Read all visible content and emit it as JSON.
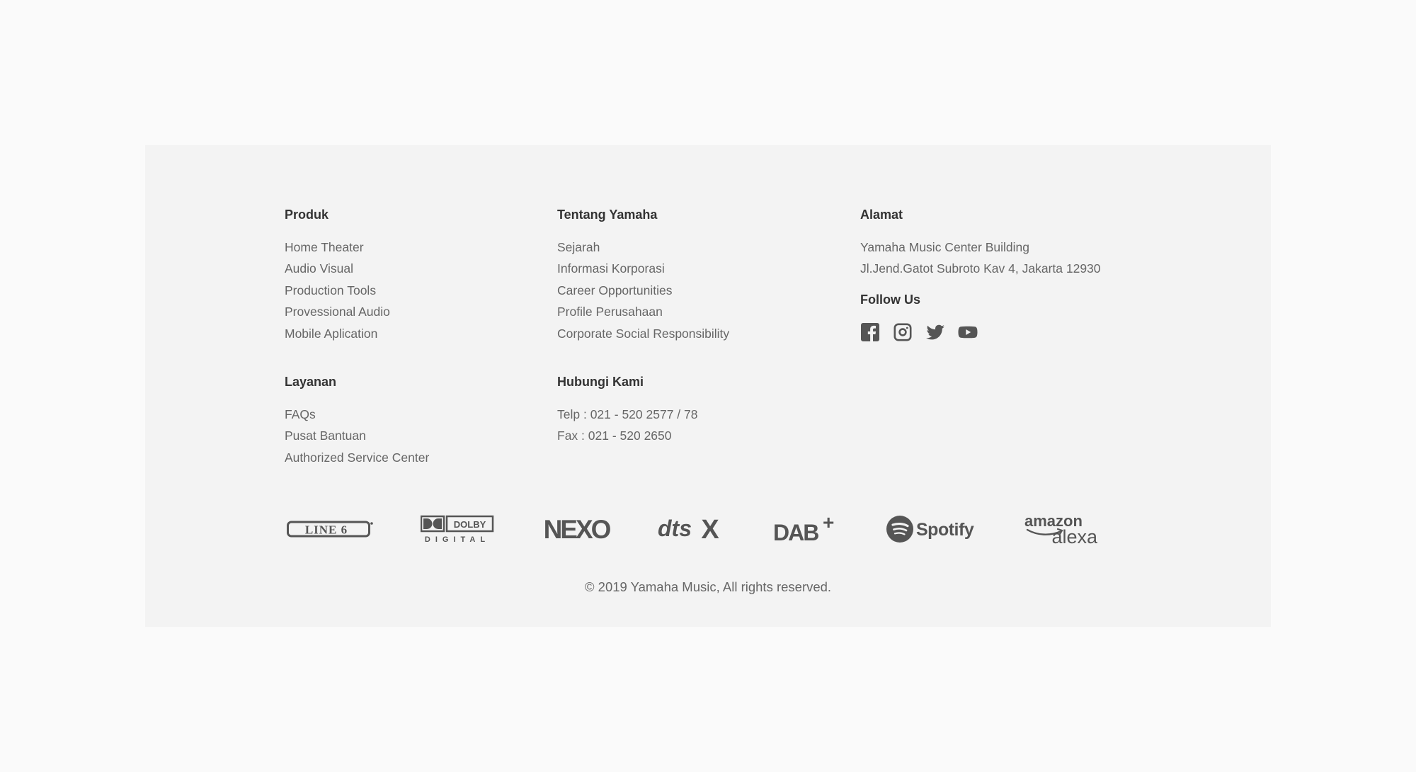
{
  "footer": {
    "produk": {
      "title": "Produk",
      "items": [
        "Home Theater",
        "Audio Visual",
        "Production Tools",
        "Provessional Audio",
        "Mobile Aplication"
      ]
    },
    "tentang": {
      "title": "Tentang Yamaha",
      "items": [
        "Sejarah",
        "Informasi Korporasi",
        "Career Opportunities",
        "Profile Perusahaan",
        "Corporate Social Responsibility"
      ]
    },
    "alamat": {
      "title": "Alamat",
      "lines": [
        "Yamaha Music Center Building",
        "Jl.Jend.Gatot Subroto Kav 4, Jakarta 12930"
      ]
    },
    "follow": {
      "title": "Follow Us",
      "icons": [
        "facebook-icon",
        "instagram-icon",
        "twitter-icon",
        "youtube-icon"
      ]
    },
    "layanan": {
      "title": "Layanan",
      "items": [
        "FAQs",
        "Pusat Bantuan",
        "Authorized Service Center"
      ]
    },
    "hubungi": {
      "title": "Hubungi Kami",
      "items": [
        "Telp : 021 - 520 2577 / 78",
        "Fax : 021 - 520 2650"
      ]
    },
    "partners": {
      "line6": "LINE 6",
      "dolby_top": "DOLBY",
      "dolby_bottom": "DIGITAL",
      "nexo": "NEXO",
      "dts": "dts",
      "dts_x": "X",
      "dab": "DAB",
      "dab_plus": "+",
      "spotify": "Spotify",
      "amazon": "amazon",
      "alexa": "alexa"
    },
    "copyright": "© 2019 Yamaha Music, All rights reserved."
  },
  "colors": {
    "page_bg": "#fafafa",
    "footer_bg": "#f3f3f3",
    "heading": "#333333",
    "text": "#666666",
    "icon": "#555555"
  }
}
